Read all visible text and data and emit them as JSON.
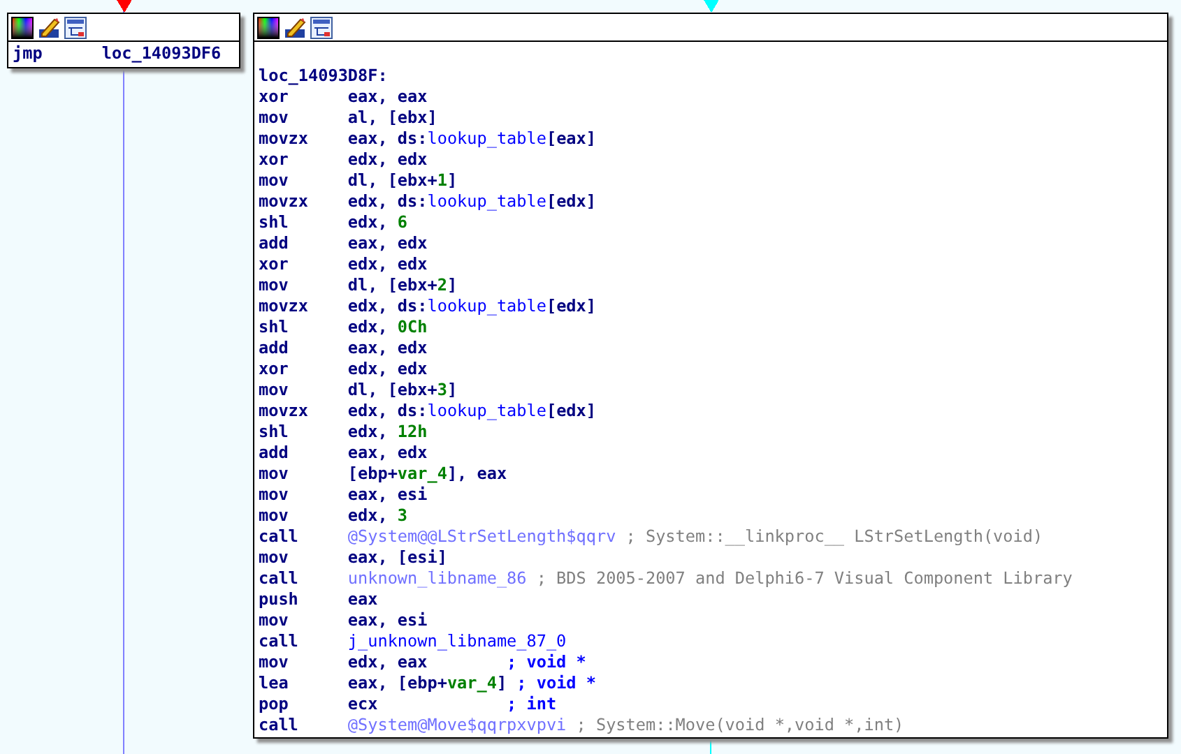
{
  "arrows": [
    {
      "kind": "false_branch"
    },
    {
      "kind": "highlighted"
    }
  ],
  "nodes": [
    {
      "lines": [
        [
          {
            "kind": "mnemonic",
            "text": "jmp"
          },
          {
            "kind": "label",
            "text": "loc_14093DF6"
          }
        ]
      ]
    },
    {
      "label": "loc_14093D8F:",
      "lines": [
        [
          {
            "kind": "mnemonic",
            "text": "xor"
          },
          {
            "kind": "plain",
            "text": "eax, eax"
          }
        ],
        [
          {
            "kind": "mnemonic",
            "text": "mov"
          },
          {
            "kind": "plain",
            "text": "al, [ebx]"
          }
        ],
        [
          {
            "kind": "mnemonic",
            "text": "movzx"
          },
          {
            "kind": "plain",
            "text": "eax, ds:"
          },
          {
            "kind": "name",
            "text": "lookup_table"
          },
          {
            "kind": "plain",
            "text": "[eax]"
          }
        ],
        [
          {
            "kind": "mnemonic",
            "text": "xor"
          },
          {
            "kind": "plain",
            "text": "edx, edx"
          }
        ],
        [
          {
            "kind": "mnemonic",
            "text": "mov"
          },
          {
            "kind": "plain",
            "text": "dl, [ebx+"
          },
          {
            "kind": "number",
            "text": "1"
          },
          {
            "kind": "plain",
            "text": "]"
          }
        ],
        [
          {
            "kind": "mnemonic",
            "text": "movzx"
          },
          {
            "kind": "plain",
            "text": "edx, ds:"
          },
          {
            "kind": "name",
            "text": "lookup_table"
          },
          {
            "kind": "plain",
            "text": "[edx]"
          }
        ],
        [
          {
            "kind": "mnemonic",
            "text": "shl"
          },
          {
            "kind": "plain",
            "text": "edx, "
          },
          {
            "kind": "number",
            "text": "6"
          }
        ],
        [
          {
            "kind": "mnemonic",
            "text": "add"
          },
          {
            "kind": "plain",
            "text": "eax, edx"
          }
        ],
        [
          {
            "kind": "mnemonic",
            "text": "xor"
          },
          {
            "kind": "plain",
            "text": "edx, edx"
          }
        ],
        [
          {
            "kind": "mnemonic",
            "text": "mov"
          },
          {
            "kind": "plain",
            "text": "dl, [ebx+"
          },
          {
            "kind": "number",
            "text": "2"
          },
          {
            "kind": "plain",
            "text": "]"
          }
        ],
        [
          {
            "kind": "mnemonic",
            "text": "movzx"
          },
          {
            "kind": "plain",
            "text": "edx, ds:"
          },
          {
            "kind": "name",
            "text": "lookup_table"
          },
          {
            "kind": "plain",
            "text": "[edx]"
          }
        ],
        [
          {
            "kind": "mnemonic",
            "text": "shl"
          },
          {
            "kind": "plain",
            "text": "edx, "
          },
          {
            "kind": "number",
            "text": "0Ch"
          }
        ],
        [
          {
            "kind": "mnemonic",
            "text": "add"
          },
          {
            "kind": "plain",
            "text": "eax, edx"
          }
        ],
        [
          {
            "kind": "mnemonic",
            "text": "xor"
          },
          {
            "kind": "plain",
            "text": "edx, edx"
          }
        ],
        [
          {
            "kind": "mnemonic",
            "text": "mov"
          },
          {
            "kind": "plain",
            "text": "dl, [ebx+"
          },
          {
            "kind": "number",
            "text": "3"
          },
          {
            "kind": "plain",
            "text": "]"
          }
        ],
        [
          {
            "kind": "mnemonic",
            "text": "movzx"
          },
          {
            "kind": "plain",
            "text": "edx, ds:"
          },
          {
            "kind": "name",
            "text": "lookup_table"
          },
          {
            "kind": "plain",
            "text": "[edx]"
          }
        ],
        [
          {
            "kind": "mnemonic",
            "text": "shl"
          },
          {
            "kind": "plain",
            "text": "edx, "
          },
          {
            "kind": "number",
            "text": "12h"
          }
        ],
        [
          {
            "kind": "mnemonic",
            "text": "add"
          },
          {
            "kind": "plain",
            "text": "eax, edx"
          }
        ],
        [
          {
            "kind": "mnemonic",
            "text": "mov"
          },
          {
            "kind": "plain",
            "text": "[ebp+"
          },
          {
            "kind": "number",
            "text": "var_4"
          },
          {
            "kind": "plain",
            "text": "], eax"
          }
        ],
        [
          {
            "kind": "mnemonic",
            "text": "mov"
          },
          {
            "kind": "plain",
            "text": "eax, esi"
          }
        ],
        [
          {
            "kind": "mnemonic",
            "text": "mov"
          },
          {
            "kind": "plain",
            "text": "edx, "
          },
          {
            "kind": "number",
            "text": "3"
          }
        ],
        [
          {
            "kind": "mnemonic",
            "text": "call"
          },
          {
            "kind": "libname",
            "text": "@System@@LStrSetLength$qqrv"
          },
          {
            "kind": "comment",
            "text": " ; System::__linkproc__ LStrSetLength(void)"
          }
        ],
        [
          {
            "kind": "mnemonic",
            "text": "mov"
          },
          {
            "kind": "plain",
            "text": "eax, [esi]"
          }
        ],
        [
          {
            "kind": "mnemonic",
            "text": "call"
          },
          {
            "kind": "libname",
            "text": "unknown_libname_86"
          },
          {
            "kind": "comment",
            "text": " ; BDS 2005-2007 and Delphi6-7 Visual Component Library"
          }
        ],
        [
          {
            "kind": "mnemonic",
            "text": "push"
          },
          {
            "kind": "plain",
            "text": "eax"
          }
        ],
        [
          {
            "kind": "mnemonic",
            "text": "mov"
          },
          {
            "kind": "plain",
            "text": "eax, esi"
          }
        ],
        [
          {
            "kind": "mnemonic",
            "text": "call"
          },
          {
            "kind": "name",
            "text": "j_unknown_libname_87_0"
          }
        ],
        [
          {
            "kind": "mnemonic",
            "text": "mov"
          },
          {
            "kind": "plain",
            "text": "edx, eax        "
          },
          {
            "kind": "type_comment",
            "text": "; void *"
          }
        ],
        [
          {
            "kind": "mnemonic",
            "text": "lea"
          },
          {
            "kind": "plain",
            "text": "eax, [ebp+"
          },
          {
            "kind": "number",
            "text": "var_4"
          },
          {
            "kind": "plain",
            "text": "] "
          },
          {
            "kind": "type_comment",
            "text": "; void *"
          }
        ],
        [
          {
            "kind": "mnemonic",
            "text": "pop"
          },
          {
            "kind": "plain",
            "text": "ecx             "
          },
          {
            "kind": "type_comment",
            "text": "; int"
          }
        ],
        [
          {
            "kind": "mnemonic",
            "text": "call"
          },
          {
            "kind": "libname",
            "text": "@System@Move$qqrpxvpvi"
          },
          {
            "kind": "comment",
            "text": " ; System::Move(void *,void *,int)"
          }
        ]
      ]
    }
  ]
}
